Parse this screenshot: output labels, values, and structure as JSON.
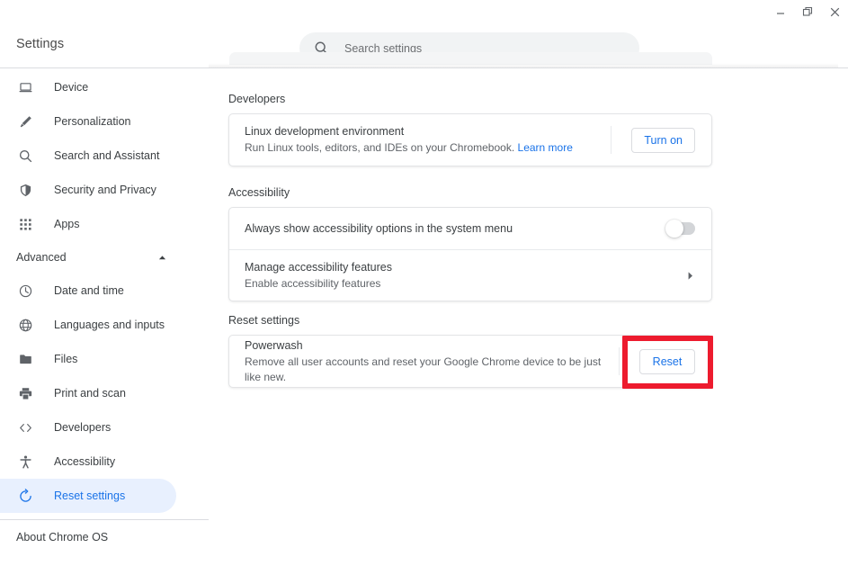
{
  "window": {
    "controls": [
      {
        "name": "minimize",
        "label": "Minimize"
      },
      {
        "name": "restore",
        "label": "Restore"
      },
      {
        "name": "close",
        "label": "Close"
      }
    ]
  },
  "header": {
    "title": "Settings",
    "search": {
      "placeholder": "Search settings",
      "value": "",
      "icon": "search-icon"
    }
  },
  "sidebar": {
    "items": [
      {
        "label": "Device",
        "icon": "laptop-icon",
        "selected": false
      },
      {
        "label": "Personalization",
        "icon": "brush-icon",
        "selected": false
      },
      {
        "label": "Search and Assistant",
        "icon": "search-icon",
        "selected": false
      },
      {
        "label": "Security and Privacy",
        "icon": "shield-icon",
        "selected": false
      },
      {
        "label": "Apps",
        "icon": "grid-icon",
        "selected": false
      }
    ],
    "advanced": {
      "label": "Advanced",
      "expanded": true,
      "caret_icon": "chevron-up-icon",
      "items": [
        {
          "label": "Date and time",
          "icon": "clock-icon",
          "selected": false
        },
        {
          "label": "Languages and inputs",
          "icon": "globe-icon",
          "selected": false
        },
        {
          "label": "Files",
          "icon": "folder-icon",
          "selected": false
        },
        {
          "label": "Print and scan",
          "icon": "printer-icon",
          "selected": false
        },
        {
          "label": "Developers",
          "icon": "code-icon",
          "selected": false
        },
        {
          "label": "Accessibility",
          "icon": "accessibility-icon",
          "selected": false
        },
        {
          "label": "Reset settings",
          "icon": "restore-icon",
          "selected": true
        }
      ]
    },
    "about": {
      "label": "About Chrome OS"
    }
  },
  "main": {
    "sections": [
      {
        "id": "developers",
        "title": "Developers",
        "rows": [
          {
            "title": "Linux development environment",
            "subtitle": "Run Linux tools, editors, and IDEs on your Chromebook.",
            "link": "Learn more",
            "action": "Turn on"
          }
        ]
      },
      {
        "id": "accessibility",
        "title": "Accessibility",
        "rows": [
          {
            "title": "Always show accessibility options in the system menu",
            "toggle_state": "off"
          },
          {
            "title": "Manage accessibility features",
            "subtitle": "Enable accessibility features",
            "chevron": "chevron-right-icon"
          }
        ]
      },
      {
        "id": "reset-settings",
        "title": "Reset settings",
        "rows": [
          {
            "title": "Powerwash",
            "subtitle": "Remove all user accounts and reset your Google Chrome device to be just like new.",
            "action": "Reset",
            "highlighted": true
          }
        ]
      }
    ]
  },
  "annotation": {
    "color": "#ed1b2e",
    "target": "reset-button"
  },
  "colors": {
    "accent": "#1a73e8",
    "selected_bg": "#e8f0fe",
    "text_primary": "#3c4043",
    "text_secondary": "#5f6368",
    "search_bg": "#f1f3f4",
    "annotation_red": "#ed1b2e"
  }
}
